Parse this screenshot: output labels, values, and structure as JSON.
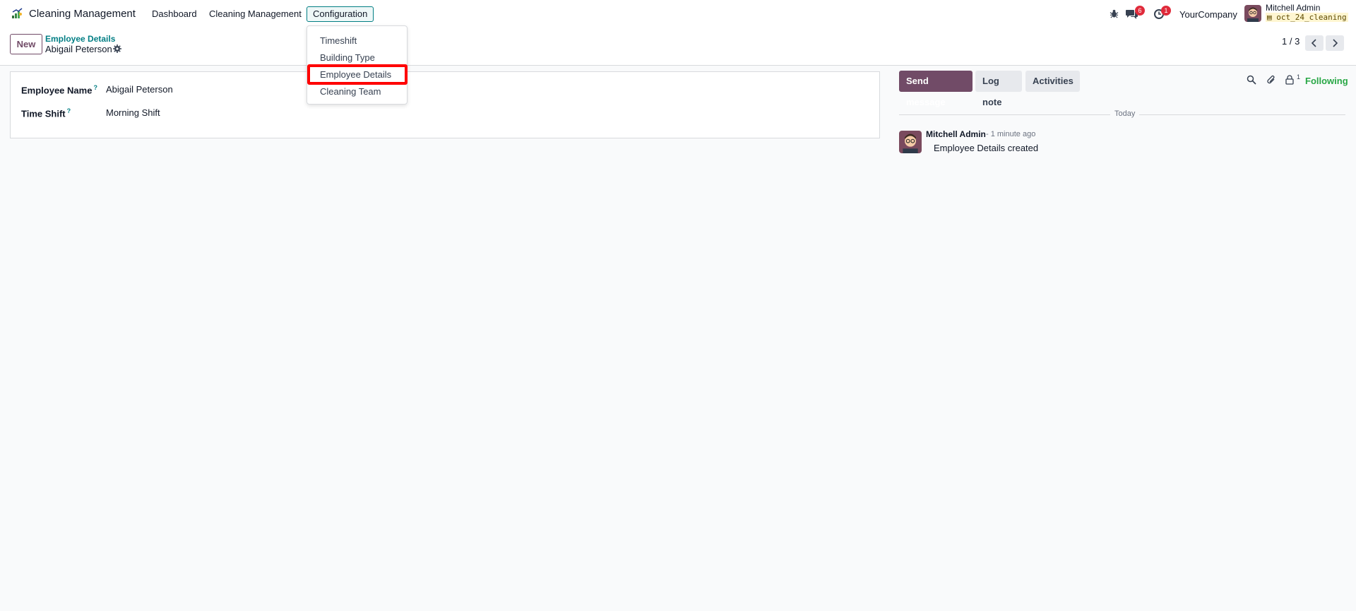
{
  "app": {
    "brand": "Cleaning Management",
    "menu": [
      {
        "label": "Dashboard"
      },
      {
        "label": "Cleaning Management"
      },
      {
        "label": "Configuration"
      }
    ]
  },
  "systray": {
    "messages_badge": "6",
    "activities_badge": "1",
    "company": "YourCompany",
    "user_name": "Mitchell Admin",
    "database": "oct_24_cleaning"
  },
  "control_panel": {
    "new_label": "New",
    "breadcrumb_parent": "Employee Details",
    "breadcrumb_current": "Abigail Peterson",
    "pager": "1 / 3"
  },
  "form": {
    "fields": [
      {
        "label": "Employee Name",
        "help": "?",
        "value": "Abigail Peterson"
      },
      {
        "label": "Time Shift",
        "help": "?",
        "value": "Morning Shift"
      }
    ]
  },
  "chatter": {
    "send_message": "Send message",
    "log_note": "Log note",
    "activities": "Activities",
    "followers_count": "1",
    "following": "Following",
    "date_separator": "Today",
    "messages": [
      {
        "author": "Mitchell Admin",
        "time": "- 1 minute ago",
        "body": "Employee Details created"
      }
    ]
  },
  "dropdown": {
    "items": [
      {
        "label": "Timeshift"
      },
      {
        "label": "Building Type"
      },
      {
        "label": "Employee Details"
      },
      {
        "label": "Cleaning Team"
      }
    ]
  },
  "colors": {
    "primary": "#714b67",
    "link": "#017e84",
    "following": "#28a745",
    "badge": "#e02b3b",
    "highlight": "#ff0000"
  }
}
